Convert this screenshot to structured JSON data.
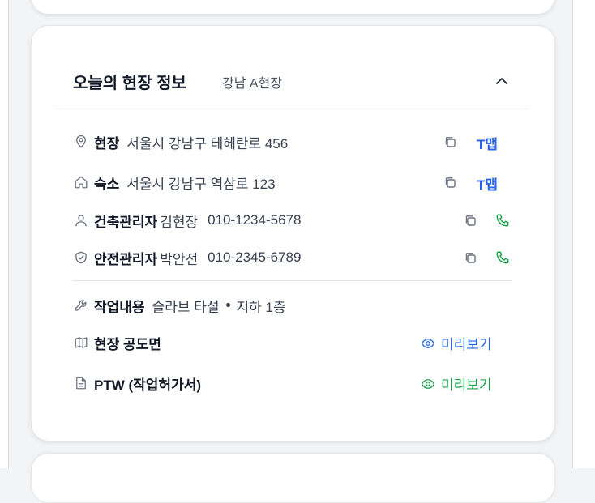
{
  "card": {
    "title": "오늘의 현장 정보",
    "subtitle": "강남 A현장"
  },
  "site": {
    "label": "현장",
    "address": "서울시 강남구 테헤란로 456",
    "map_label": "T맵"
  },
  "lodging": {
    "label": "숙소",
    "address": "서울시 강남구 역삼로 123",
    "map_label": "T맵"
  },
  "construction_manager": {
    "label": "건축관리자",
    "name": "김현장",
    "phone": "010-1234-5678"
  },
  "safety_manager": {
    "label": "안전관리자",
    "name": "박안전",
    "phone": "010-2345-6789"
  },
  "work": {
    "label": "작업내용",
    "task": "슬라브 타설",
    "location": "지하 1층"
  },
  "site_drawing": {
    "label": "현장 공도면",
    "preview_label": "미리보기"
  },
  "ptw": {
    "label": "PTW (작업허가서)",
    "preview_label": "미리보기"
  },
  "colors": {
    "link_blue": "#2563eb",
    "call_green": "#16a34a",
    "text": "#111827",
    "muted": "#6b7280"
  }
}
